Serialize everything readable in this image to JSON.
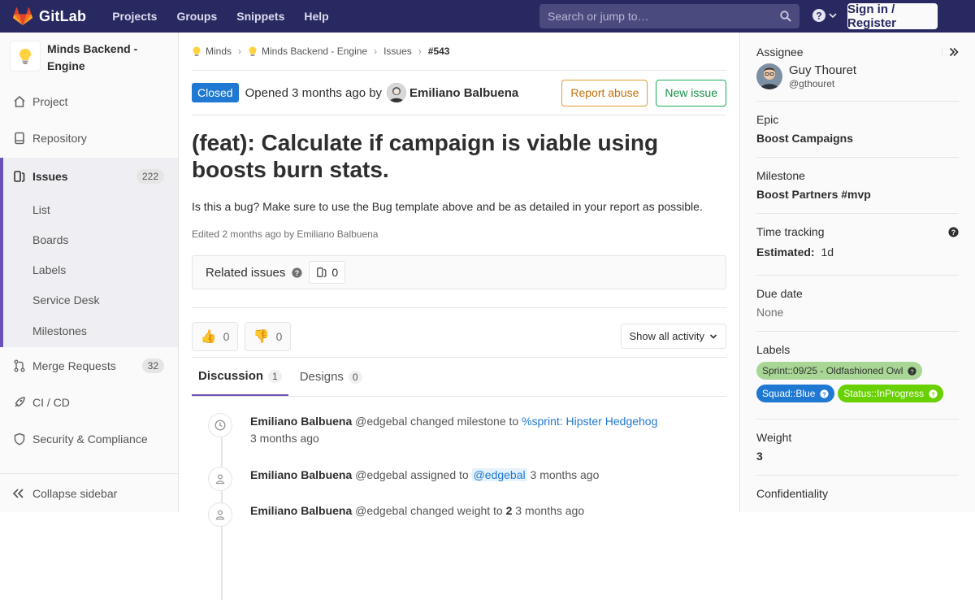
{
  "topbar": {
    "brand": "GitLab",
    "nav": [
      "Projects",
      "Groups",
      "Snippets",
      "Help"
    ],
    "search_placeholder": "Search or jump to…",
    "sign_in_label": "Sign in / Register",
    "bg_color": "#292961"
  },
  "sidebar": {
    "project_name": "Minds Backend - Engine",
    "items": [
      {
        "label": "Project",
        "icon": "home-icon"
      },
      {
        "label": "Repository",
        "icon": "repo-icon"
      }
    ],
    "issues": {
      "label": "Issues",
      "count": "222",
      "sub": [
        "List",
        "Boards",
        "Labels",
        "Service Desk",
        "Milestones"
      ]
    },
    "items_after": [
      {
        "label": "Merge Requests",
        "count": "32",
        "icon": "merge-icon"
      },
      {
        "label": "CI / CD",
        "icon": "rocket-icon"
      },
      {
        "label": "Security & Compliance",
        "icon": "shield-icon"
      }
    ],
    "collapse_label": "Collapse sidebar"
  },
  "breadcrumb": [
    "Minds",
    "Minds Backend - Engine",
    "Issues",
    "#543"
  ],
  "issue": {
    "status": "Closed",
    "opened_text": "Opened 3 months ago by",
    "author": "Emiliano Balbuena",
    "report_abuse_label": "Report abuse",
    "new_issue_label": "New issue",
    "title": "(feat): Calculate if campaign is viable using boosts burn stats.",
    "description": "Is this a bug? Make sure to use the Bug template above and be as detailed in your report as possible.",
    "edited": "Edited 2 months ago by Emiliano Balbuena",
    "related_label": "Related issues",
    "related_count": "0",
    "thumbs_up": "0",
    "thumbs_down": "0",
    "activity_filter": "Show all activity"
  },
  "tabs": [
    {
      "label": "Discussion",
      "count": "1"
    },
    {
      "label": "Designs",
      "count": "0"
    }
  ],
  "timeline": [
    {
      "author": "Emiliano Balbuena",
      "handle": "@edgebal",
      "action": "changed milestone to",
      "target": "%sprint: Hipster Hedgehog",
      "time": "3 months ago",
      "icon": "clock-icon"
    },
    {
      "author": "Emiliano Balbuena",
      "handle": "@edgebal",
      "action": "assigned to",
      "target": "@edgebal",
      "time": "3 months ago",
      "icon": "user-icon"
    },
    {
      "author": "Emiliano Balbuena",
      "handle": "@edgebal",
      "action": "changed weight to",
      "target": "2",
      "time": "3 months ago",
      "icon": "user-icon"
    }
  ],
  "right": {
    "assignee_label": "Assignee",
    "assignee_name": "Guy Thouret",
    "assignee_handle": "@gthouret",
    "epic_label": "Epic",
    "epic": "Boost Campaigns",
    "milestone_label": "Milestone",
    "milestone": "Boost Partners #mvp",
    "time_label": "Time tracking",
    "estimated_label": "Estimated:",
    "estimated_value": "1d",
    "due_label": "Due date",
    "due_value": "None",
    "labels_label": "Labels",
    "labels": [
      {
        "text": "Sprint::09/25 - Oldfashioned Owl",
        "color": "#a8d695",
        "text_color": "#333333"
      },
      {
        "text": "Squad::Blue",
        "color": "#1f78d1",
        "text_color": "#ffffff"
      },
      {
        "text": "Status::InProgress",
        "color": "#69d100",
        "text_color": "#ffffff"
      }
    ],
    "weight_label": "Weight",
    "weight_value": "3",
    "confidentiality_label": "Confidentiality"
  }
}
